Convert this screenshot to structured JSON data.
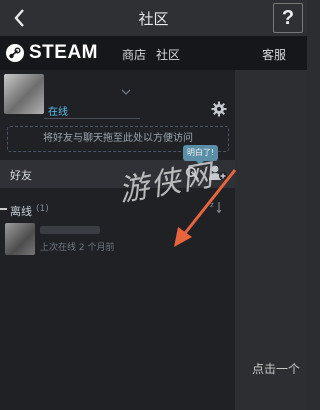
{
  "topbar": {
    "title": "社区",
    "help": "?"
  },
  "nav": {
    "logo": "STEAM",
    "store": "商店",
    "community": "社区",
    "support": "客服"
  },
  "profile": {
    "status": "在线"
  },
  "dropzone": {
    "text": "将好友与聊天拖至此处以方便访问"
  },
  "tooltip": {
    "text": "明白了!"
  },
  "search": {
    "label": "好友"
  },
  "group": {
    "label": "离线",
    "count": "(1)"
  },
  "friend": {
    "status": "上次在线 2 个月前"
  },
  "right_panel": {
    "text": "点击一个"
  },
  "watermark": {
    "text": "游侠网"
  },
  "colors": {
    "accent": "#5cc0ee",
    "arrow": "#e8643c",
    "nav_bg": "#16171a",
    "panel_bg": "#1f2125"
  }
}
